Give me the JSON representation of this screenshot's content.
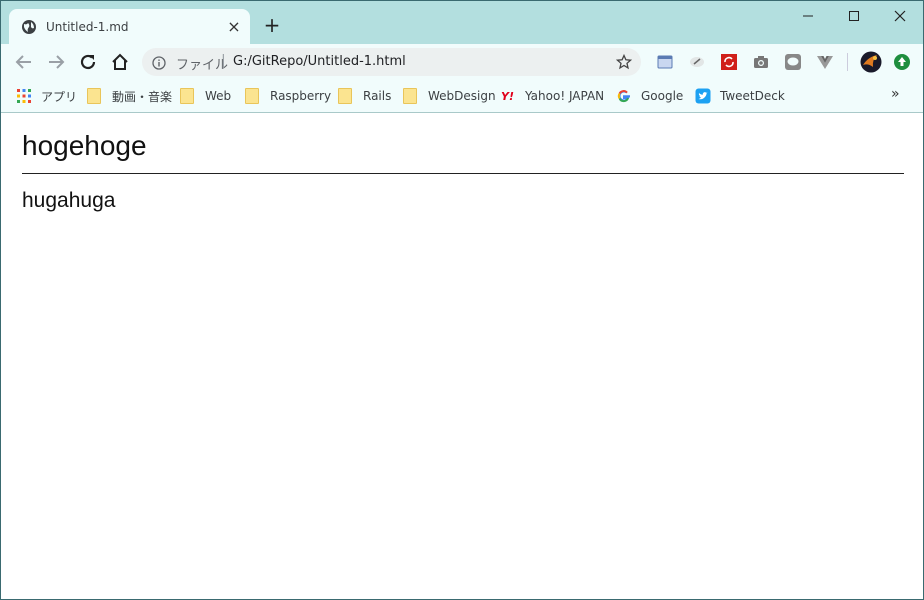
{
  "tab": {
    "title": "Untitled-1.md",
    "close_glyph": "×"
  },
  "new_tab_glyph": "+",
  "address_bar": {
    "scheme_label": "ファイル",
    "separator": "|",
    "url": "G:/GitRepo/Untitled-1.html"
  },
  "bookmarks": {
    "apps_label": "アプリ",
    "items": [
      {
        "label": "動画・音楽"
      },
      {
        "label": "Web"
      },
      {
        "label": "Raspberry"
      },
      {
        "label": "Rails"
      },
      {
        "label": "WebDesign"
      },
      {
        "label": "Yahoo! JAPAN"
      },
      {
        "label": "Google"
      },
      {
        "label": "TweetDeck"
      }
    ],
    "overflow_glyph": "»"
  },
  "page": {
    "heading": "hogehoge",
    "paragraph": "hugahuga"
  },
  "colors": {
    "tabstrip": "#b3dfdf",
    "toolbar": "#f1fcfc",
    "omnibox": "#ecf0f0"
  }
}
